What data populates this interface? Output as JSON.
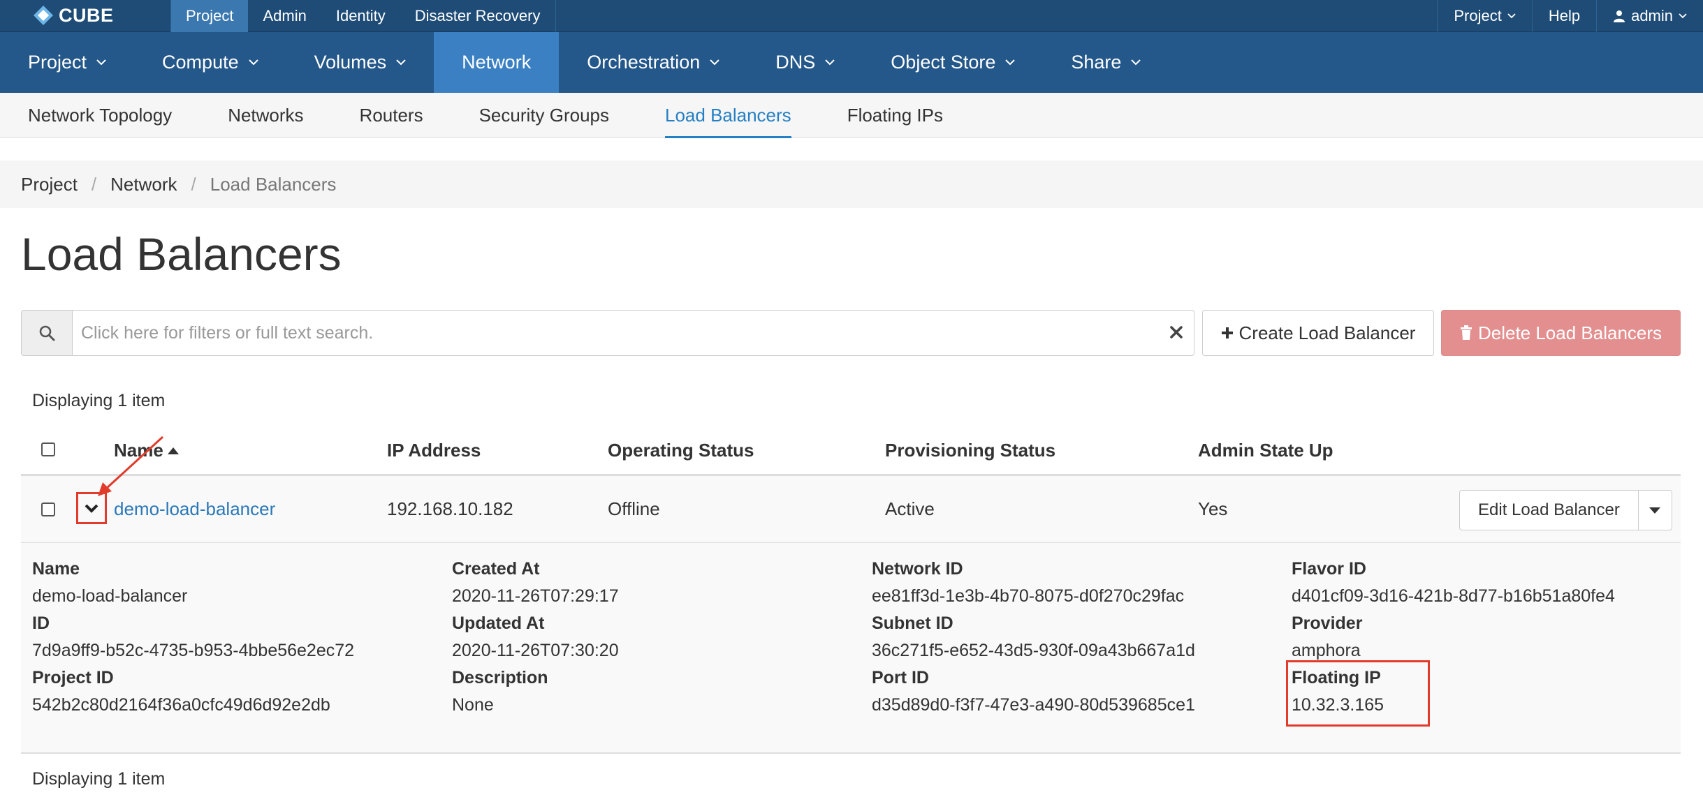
{
  "brand": {
    "name": "CUBE",
    "logo_icon": "cube-logo-icon"
  },
  "top_tabs": [
    {
      "label": "Project",
      "active": true
    },
    {
      "label": "Admin",
      "active": false
    },
    {
      "label": "Identity",
      "active": false
    },
    {
      "label": "Disaster Recovery",
      "active": false
    }
  ],
  "top_right": {
    "project_menu": "Project",
    "help": "Help",
    "user": "admin"
  },
  "main_nav": [
    {
      "label": "Project",
      "dropdown": true,
      "active": false
    },
    {
      "label": "Compute",
      "dropdown": true,
      "active": false
    },
    {
      "label": "Volumes",
      "dropdown": true,
      "active": false
    },
    {
      "label": "Network",
      "dropdown": false,
      "active": true
    },
    {
      "label": "Orchestration",
      "dropdown": true,
      "active": false
    },
    {
      "label": "DNS",
      "dropdown": true,
      "active": false
    },
    {
      "label": "Object Store",
      "dropdown": true,
      "active": false
    },
    {
      "label": "Share",
      "dropdown": true,
      "active": false
    }
  ],
  "sub_nav": [
    {
      "label": "Network Topology",
      "active": false
    },
    {
      "label": "Networks",
      "active": false
    },
    {
      "label": "Routers",
      "active": false
    },
    {
      "label": "Security Groups",
      "active": false
    },
    {
      "label": "Load Balancers",
      "active": true
    },
    {
      "label": "Floating IPs",
      "active": false
    }
  ],
  "breadcrumb": [
    "Project",
    "Network",
    "Load Balancers"
  ],
  "page_title": "Load Balancers",
  "search": {
    "placeholder": "Click here for filters or full text search.",
    "value": ""
  },
  "actions": {
    "create": "Create Load Balancer",
    "delete": "Delete Load Balancers"
  },
  "count_text": "Displaying 1 item",
  "table": {
    "columns": [
      "Name",
      "IP Address",
      "Operating Status",
      "Provisioning Status",
      "Admin State Up"
    ],
    "sort_column": "Name",
    "rows": [
      {
        "name": "demo-load-balancer",
        "ip": "192.168.10.182",
        "operating_status": "Offline",
        "provisioning_status": "Active",
        "admin_state_up": "Yes",
        "action": "Edit Load Balancer"
      }
    ]
  },
  "details": [
    [
      {
        "label": "Name",
        "value": "demo-load-balancer"
      },
      {
        "label": "ID",
        "value": "7d9a9ff9-b52c-4735-b953-4bbe56e2ec72"
      },
      {
        "label": "Project ID",
        "value": "542b2c80d2164f36a0cfc49d6d92e2db"
      }
    ],
    [
      {
        "label": "Created At",
        "value": "2020-11-26T07:29:17"
      },
      {
        "label": "Updated At",
        "value": "2020-11-26T07:30:20"
      },
      {
        "label": "Description",
        "value": "None"
      }
    ],
    [
      {
        "label": "Network ID",
        "value": "ee81ff3d-1e3b-4b70-8075-d0f270c29fac"
      },
      {
        "label": "Subnet ID",
        "value": "36c271f5-e652-43d5-930f-09a43b667a1d"
      },
      {
        "label": "Port ID",
        "value": "d35d89d0-f3f7-47e3-a490-80d539685ce1"
      }
    ],
    [
      {
        "label": "Flavor ID",
        "value": "d401cf09-3d16-421b-8d77-b16b51a80fe4"
      },
      {
        "label": "Provider",
        "value": "amphora"
      },
      {
        "label": "Floating IP",
        "value": "10.32.3.165"
      }
    ]
  ],
  "colors": {
    "topbar": "#1e4c77",
    "mainnav": "#24578a",
    "active_nav": "#3a80c2",
    "link": "#2a78b9",
    "danger": "#e38f8f",
    "annotation": "#e03b2b"
  }
}
